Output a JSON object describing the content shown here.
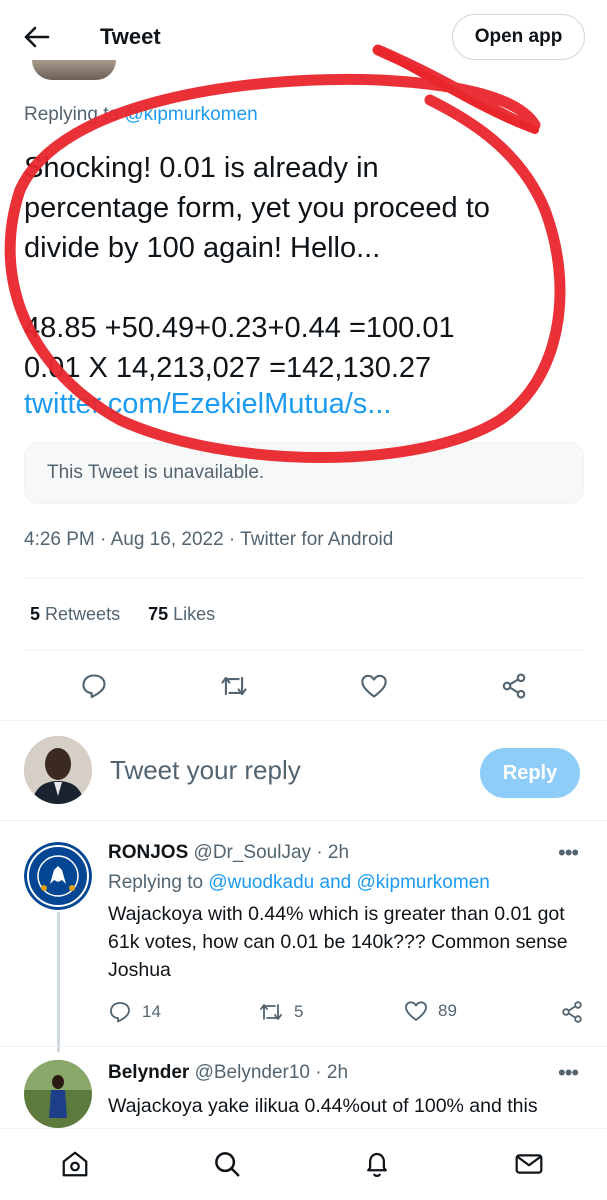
{
  "header": {
    "title": "Tweet",
    "open_app_label": "Open app",
    "back_icon": "arrow-left-icon"
  },
  "tweet": {
    "replying_prefix": "Replying to",
    "replying_to": "@kipmurkomen",
    "text": "Shocking! 0.01 is already in\npercentage form, yet you proceed to\ndivide by 100 again! Hello...\n\n48.85 +50.49+0.23+0.44 =100.01\n0.01 X 14,213,027 =142,130.27",
    "link": "twitter.com/EzekielMutua/s...",
    "quoted_unavailable": "This Tweet is unavailable.",
    "timestamp": "4:26 PM · Aug 16, 2022 · Twitter for Android",
    "retweets_count": "5",
    "retweets_label": "Retweets",
    "likes_count": "75",
    "likes_label": "Likes"
  },
  "actions": {
    "reply_icon": "reply-icon",
    "retweet_icon": "retweet-icon",
    "like_icon": "heart-icon",
    "share_icon": "share-icon"
  },
  "composer": {
    "placeholder": "Tweet your reply",
    "button_label": "Reply"
  },
  "replies": [
    {
      "name": "RONJOS",
      "handle": "@Dr_SoulJay",
      "time": "· 2h",
      "replying_prefix": "Replying to",
      "replying_to": "@wuodkadu and @kipmurkomen",
      "text": "Wajackoya with 0.44% which is greater than 0.01 got 61k votes, how can 0.01 be 140k??? Common sense Joshua",
      "reply_count": "14",
      "retweet_count": "5",
      "like_count": "89",
      "more": "•••"
    },
    {
      "name": "Belynder",
      "handle": "@Belynder10",
      "time": "· 2h",
      "text": "Wajackoya yake ilikua 0.44%out of 100% and this",
      "more": "•••"
    }
  ],
  "bottom_nav": [
    "home-icon",
    "search-icon",
    "notifications-icon",
    "messages-icon"
  ],
  "colors": {
    "accent": "#1d9bf0",
    "annotation": "#e8262c",
    "reply_button": "#8ecdf8"
  }
}
